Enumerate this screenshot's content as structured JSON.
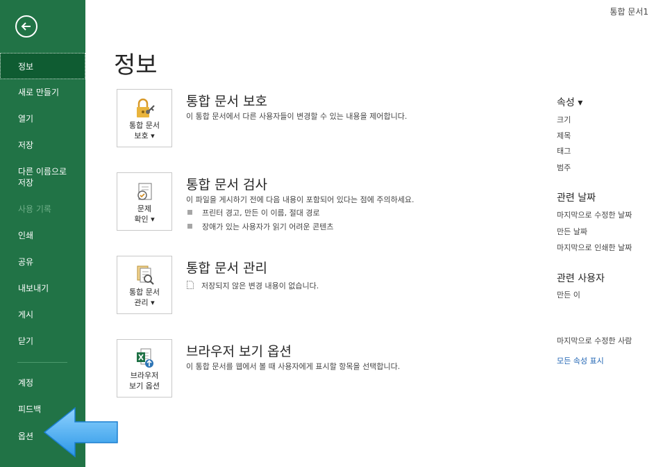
{
  "window": {
    "doc_title": "통합 문서1"
  },
  "sidebar": {
    "items": [
      {
        "label": "정보"
      },
      {
        "label": "새로 만들기"
      },
      {
        "label": "열기"
      },
      {
        "label": "저장"
      },
      {
        "label": "다른 이름으로\n저장"
      },
      {
        "label": "사용 기록"
      },
      {
        "label": "인쇄"
      },
      {
        "label": "공유"
      },
      {
        "label": "내보내기"
      },
      {
        "label": "게시"
      },
      {
        "label": "닫기"
      },
      {
        "label": "계정"
      },
      {
        "label": "피드백"
      },
      {
        "label": "옵션"
      }
    ]
  },
  "main": {
    "title": "정보",
    "sections": [
      {
        "button": "통합 문서\n보호 ▾",
        "title": "통합 문서 보호",
        "desc": "이 통합 문서에서 다른 사용자들이 변경할 수 있는 내용을 제어합니다."
      },
      {
        "button": "문제\n확인 ▾",
        "title": "통합 문서 검사",
        "desc": "이 파일을 게시하기 전에 다음 내용이 포함되어 있다는 점에 주의하세요.",
        "bullets": [
          "프린터 경고, 만든 이 이름, 절대 경로",
          "장애가 있는 사용자가 읽기 어려운 콘텐츠"
        ]
      },
      {
        "button": "통합 문서\n관리 ▾",
        "title": "통합 문서 관리",
        "desc": "저장되지 않은 변경 내용이 없습니다."
      },
      {
        "button": "브라우저\n보기 옵션",
        "title": "브라우저 보기 옵션",
        "desc": "이 통합 문서를 웹에서 볼 때 사용자에게 표시할 항목을 선택합니다."
      }
    ]
  },
  "right": {
    "properties_head": "속성 ▾",
    "properties": [
      "크기",
      "제목",
      "태그",
      "범주"
    ],
    "dates_head": "관련 날짜",
    "dates": [
      "마지막으로 수정한 날짜",
      "만든 날짜",
      "마지막으로 인쇄한 날짜"
    ],
    "people_head": "관련 사용자",
    "people": [
      "만든 이"
    ],
    "last_modified_by": "마지막으로 수정한 사람",
    "show_all": "모든 속성 표시"
  },
  "colors": {
    "sidebar": "#217346",
    "selected": "#0f5c32",
    "link": "#2266b4",
    "arrow": "#3da8ee"
  }
}
